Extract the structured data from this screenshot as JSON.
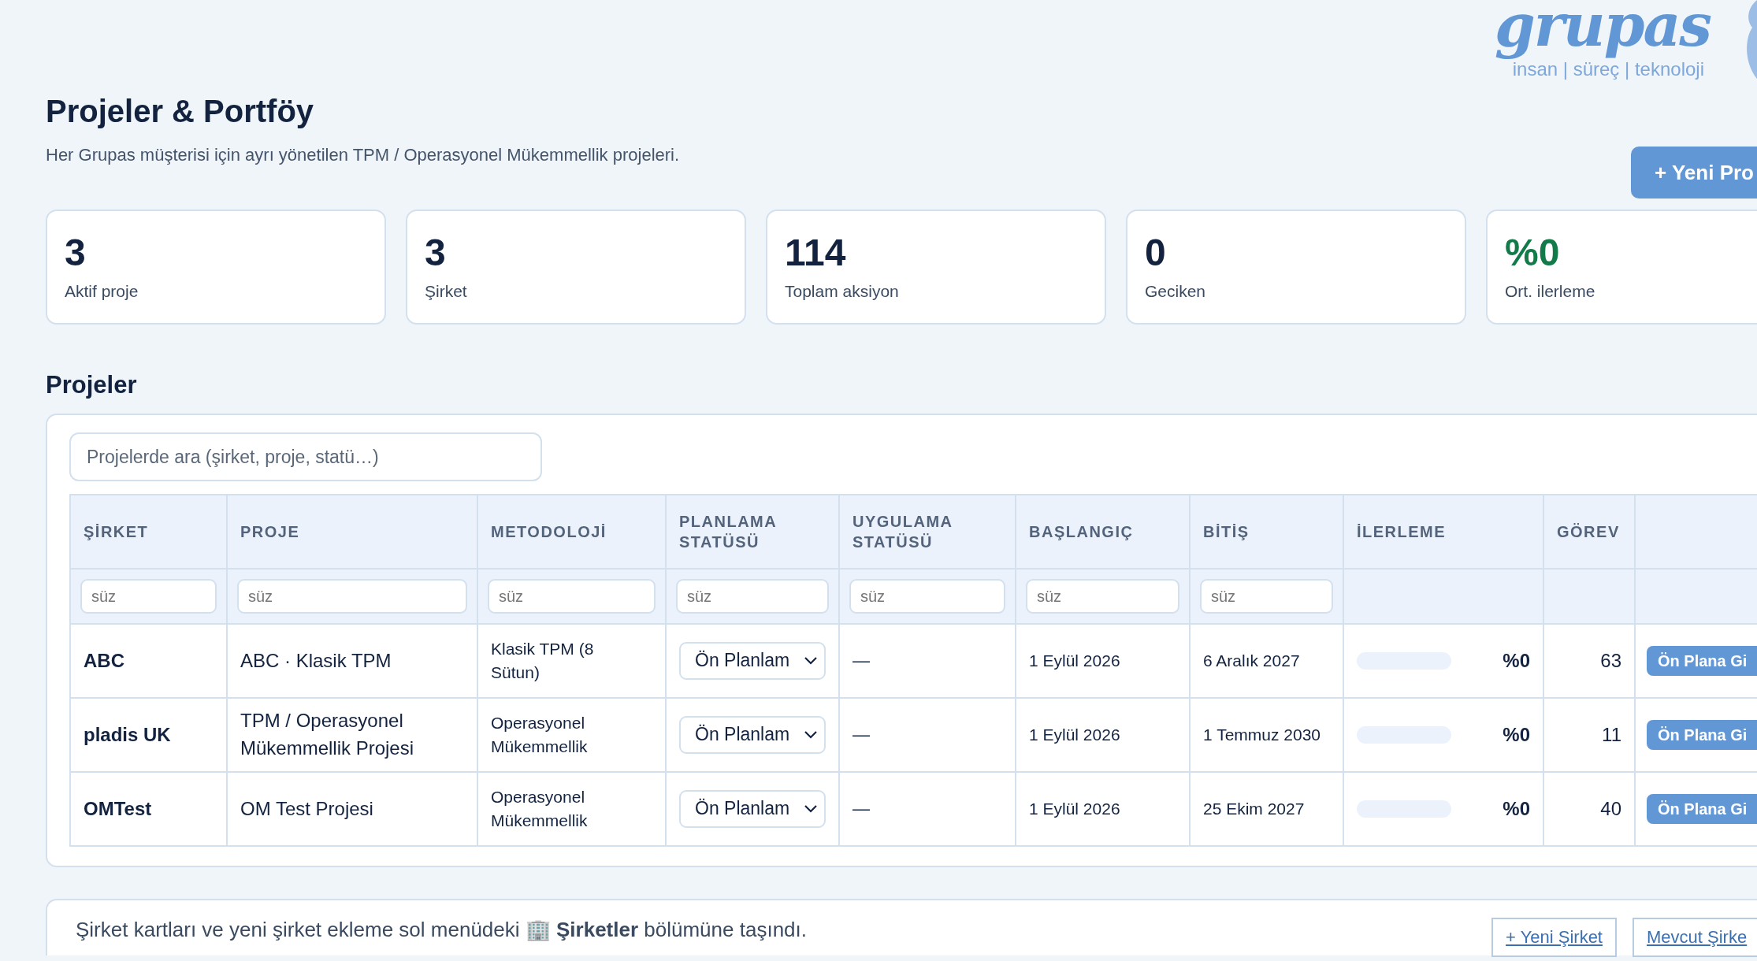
{
  "logo": {
    "wordmark": "grupas",
    "tagline": "insan | süreç | teknoloji"
  },
  "page": {
    "title": "Projeler & Portföy",
    "subtitle": "Her Grupas müşterisi için ayrı yönetilen TPM / Operasyonel Mükemmellik projeleri.",
    "new_button": "+ Yeni Pro"
  },
  "stats": [
    {
      "value": "3",
      "label": "Aktif proje",
      "color": "#13233f"
    },
    {
      "value": "3",
      "label": "Şirket",
      "color": "#13233f"
    },
    {
      "value": "114",
      "label": "Toplam aksiyon",
      "color": "#13233f"
    },
    {
      "value": "0",
      "label": "Geciken",
      "color": "#13233f"
    },
    {
      "value": "%0",
      "label": "Ort. ilerleme",
      "color": "#137a4a"
    }
  ],
  "projects": {
    "title": "Projeler",
    "search": {
      "placeholder": "Projelerde ara (şirket, proje, statü…)"
    },
    "columns": [
      {
        "label": "ŞİRKET",
        "placeholder": "süz"
      },
      {
        "label": "PROJE",
        "placeholder": "süz"
      },
      {
        "label": "METODOLOJİ",
        "placeholder": "süz"
      },
      {
        "label": "PLANLAMA STATÜSÜ",
        "placeholder": "süz"
      },
      {
        "label": "UYGULAMA STATÜSÜ",
        "placeholder": "süz"
      },
      {
        "label": "BAŞLANGIÇ",
        "placeholder": "süz"
      },
      {
        "label": "BİTİŞ",
        "placeholder": "süz"
      },
      {
        "label": "İLERLEME"
      },
      {
        "label": "GÖREV"
      }
    ],
    "rows": [
      {
        "company": "ABC",
        "project": "ABC · Klasik TPM",
        "methodology": "Klasik TPM (8 Sütun)",
        "planning_status": "Ön Planlam",
        "execution_status": "—",
        "start": "1 Eylül 2026",
        "end": "6 Aralık 2027",
        "level": 0,
        "progress": "%0",
        "tasks": "63",
        "action": "Ön Plana Gi"
      },
      {
        "company": "pladis UK",
        "project": "TPM / Operasyonel Mükemmellik Projesi",
        "methodology": "Operasyonel Mükemmellik",
        "planning_status": "Ön Planlam",
        "execution_status": "—",
        "start": "1 Eylül 2026",
        "end": "1 Temmuz 2030",
        "level": 0,
        "progress": "%0",
        "tasks": "11",
        "action": "Ön Plana Gi"
      },
      {
        "company": "OMTest",
        "project": "OM Test Projesi",
        "methodology": "Operasyonel Mükemmellik",
        "planning_status": "Ön Planlam",
        "execution_status": "—",
        "start": "1 Eylül 2026",
        "end": "25 Ekim 2027",
        "level": 0,
        "progress": "%0",
        "tasks": "40",
        "action": "Ön Plana Gi"
      }
    ]
  },
  "footer": {
    "note": "Şirket kartları ve yeni şirket ekleme sol menüdeki 🏢 **Şirketler** bölümüne taşındı.",
    "buttons": [
      "+ Yeni Şirket",
      "Mevcut Şirke"
    ]
  }
}
